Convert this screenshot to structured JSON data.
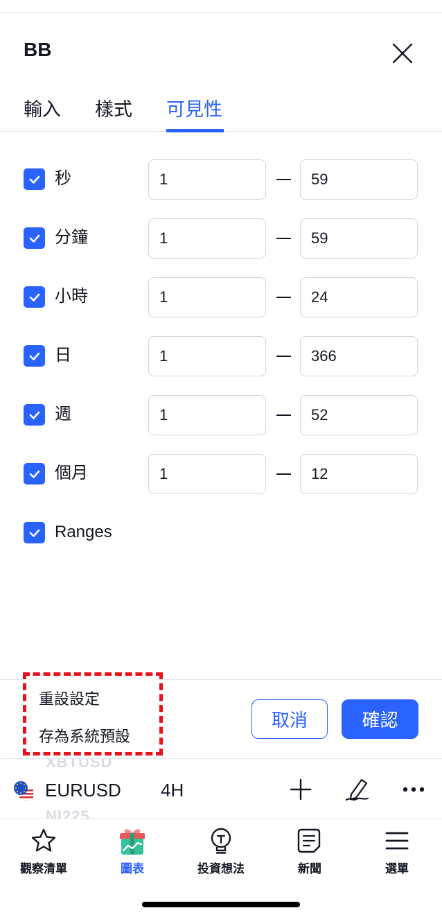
{
  "dialog": {
    "title": "BB",
    "tabs": [
      {
        "label": "輸入",
        "active": false
      },
      {
        "label": "樣式",
        "active": false
      },
      {
        "label": "可見性",
        "active": true
      }
    ]
  },
  "visibility_rows": [
    {
      "label": "秒",
      "checked": true,
      "from": "1",
      "to": "59"
    },
    {
      "label": "分鐘",
      "checked": true,
      "from": "1",
      "to": "59"
    },
    {
      "label": "小時",
      "checked": true,
      "from": "1",
      "to": "24"
    },
    {
      "label": "日",
      "checked": true,
      "from": "1",
      "to": "366"
    },
    {
      "label": "週",
      "checked": true,
      "from": "1",
      "to": "52"
    },
    {
      "label": "個月",
      "checked": true,
      "from": "1",
      "to": "12"
    },
    {
      "label": "Ranges",
      "checked": true
    }
  ],
  "defaults_menu": {
    "items": [
      "重設設定",
      "存為系統預設"
    ]
  },
  "buttons": {
    "cancel": "取消",
    "confirm": "確認"
  },
  "toolbar": {
    "symbol": "EURUSD",
    "interval": "4H",
    "ghost_above": "XBTUSD",
    "ghost_below": "NI225"
  },
  "bottom_nav": [
    {
      "label": "觀察清單",
      "icon": "star-icon",
      "active": false
    },
    {
      "label": "圖表",
      "icon": "gift-chart-icon",
      "active": true
    },
    {
      "label": "投資想法",
      "icon": "lightbulb-icon",
      "active": false
    },
    {
      "label": "新聞",
      "icon": "news-icon",
      "active": false
    },
    {
      "label": "選單",
      "icon": "menu-icon",
      "active": false
    }
  ],
  "colors": {
    "accent": "#2962ff",
    "text": "#131722",
    "border": "#d1d4dc",
    "highlight_dash": "#e8121b"
  }
}
